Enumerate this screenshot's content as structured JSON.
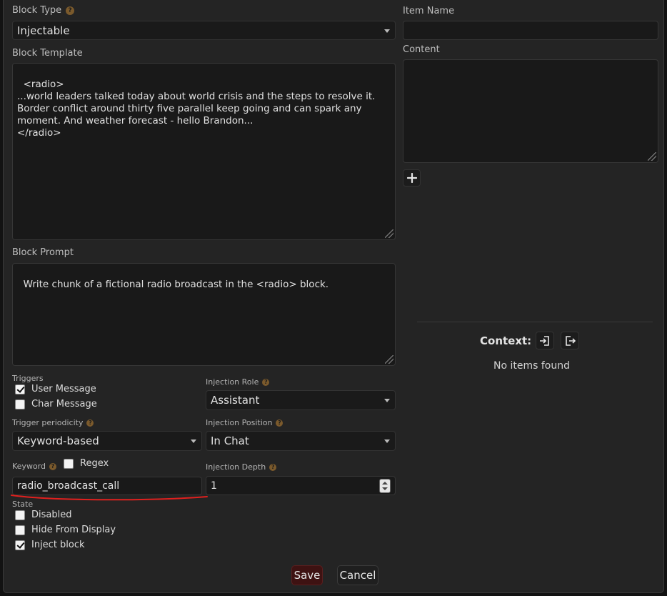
{
  "block_type": {
    "label": "Block Type",
    "value": "Injectable"
  },
  "block_template": {
    "label": "Block Template",
    "value": "<radio>\n...world leaders talked today about world crisis and the steps to resolve it. Border conflict around thirty five parallel keep going and can spark any moment. And weather forecast - hello Brandon...\n</radio>"
  },
  "block_prompt": {
    "label": "Block Prompt",
    "value": "Write chunk of a fictional radio broadcast in the <radio> block."
  },
  "triggers": {
    "label": "Triggers",
    "items": [
      {
        "label": "User Message",
        "checked": true
      },
      {
        "label": "Char Message",
        "checked": false
      }
    ]
  },
  "trigger_periodicity": {
    "label": "Trigger periodicity",
    "value": "Keyword-based"
  },
  "keyword": {
    "label": "Keyword",
    "value": "radio_broadcast_call",
    "regex_label": "Regex",
    "regex_checked": false
  },
  "state": {
    "label": "State",
    "items": [
      {
        "label": "Disabled",
        "checked": false
      },
      {
        "label": "Hide From Display",
        "checked": false
      },
      {
        "label": "Inject block",
        "checked": true
      }
    ]
  },
  "injection_role": {
    "label": "Injection Role",
    "value": "Assistant"
  },
  "injection_position": {
    "label": "Injection Position",
    "value": "In Chat"
  },
  "injection_depth": {
    "label": "Injection Depth",
    "value": "1"
  },
  "item_name": {
    "label": "Item Name",
    "value": ""
  },
  "content": {
    "label": "Content",
    "value": ""
  },
  "context": {
    "label": "Context:",
    "empty_text": "No items found"
  },
  "buttons": {
    "save": "Save",
    "cancel": "Cancel"
  },
  "help_glyph": "?",
  "colors": {
    "accent_red": "#e0201e",
    "save_bg": "#3e1212",
    "help_badge": "#7b5a2c"
  },
  "annotation": {
    "type": "red-underline",
    "target": "keyword-input"
  }
}
